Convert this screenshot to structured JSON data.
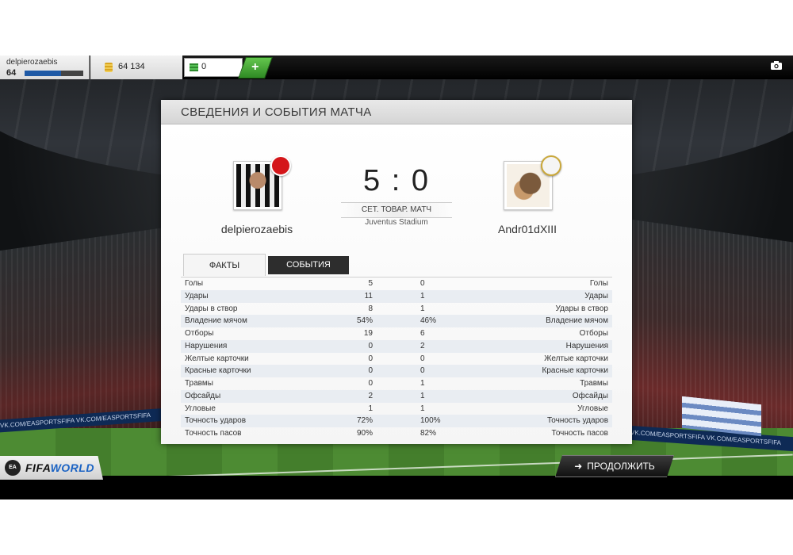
{
  "topbar": {
    "username": "delpierozaebis",
    "level": "64",
    "xp_fraction": 0.62,
    "coins": "64 134",
    "points": "0",
    "add_label": "+"
  },
  "panel": {
    "title": "СВЕДЕНИЯ И СОБЫТИЯ МАТЧА",
    "home_player": "delpierozaebis",
    "away_player": "Andr01dXIII",
    "score": "5 : 0",
    "match_type": "СЕТ. ТОВАР. МАТЧ",
    "stadium": "Juventus Stadium",
    "tabs": [
      {
        "label": "ФАКТЫ",
        "active": true
      },
      {
        "label": "СОБЫТИЯ",
        "active": false
      }
    ],
    "stats": [
      {
        "label": "Голы",
        "home": "5",
        "away": "0"
      },
      {
        "label": "Удары",
        "home": "11",
        "away": "1"
      },
      {
        "label": "Удары в створ",
        "home": "8",
        "away": "1"
      },
      {
        "label": "Владение мячом",
        "home": "54%",
        "away": "46%"
      },
      {
        "label": "Отборы",
        "home": "19",
        "away": "6"
      },
      {
        "label": "Нарушения",
        "home": "0",
        "away": "2"
      },
      {
        "label": "Желтые карточки",
        "home": "0",
        "away": "0"
      },
      {
        "label": "Красные карточки",
        "home": "0",
        "away": "0"
      },
      {
        "label": "Травмы",
        "home": "0",
        "away": "1"
      },
      {
        "label": "Офсайды",
        "home": "2",
        "away": "1"
      },
      {
        "label": "Угловые",
        "home": "1",
        "away": "1"
      },
      {
        "label": "Точность ударов",
        "home": "72%",
        "away": "100%"
      },
      {
        "label": "Точность пасов",
        "home": "90%",
        "away": "82%"
      }
    ]
  },
  "bottom": {
    "continue_label": "ПРОДОЛЖИТЬ",
    "logo_fifa": "FIFA",
    "logo_world": "WORLD",
    "ea_label": "EA"
  },
  "background": {
    "adboard_left": "VK.COM/EASPORTSFIFA   VK.COM/EASPORTSFIFA",
    "adboard_right": "VK.COM/EASPORTSFIFA   VK.COM/EASPORTSFIFA"
  },
  "colors": {
    "accent_green": "#3fa32e",
    "xp_blue": "#1f5aa6",
    "tab_dark": "#2d2d2d"
  }
}
